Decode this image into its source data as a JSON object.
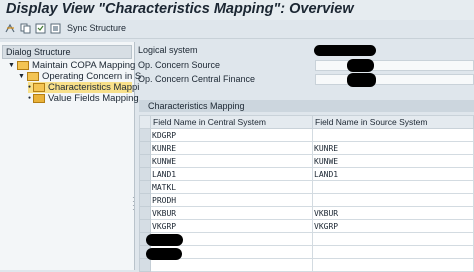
{
  "header": {
    "title": "Display View \"Characteristics Mapping\": Overview"
  },
  "toolbar": {
    "sync_label": "Sync Structure"
  },
  "dialog_structure": {
    "title": "Dialog Structure",
    "items": [
      {
        "label": "Maintain COPA Mapping",
        "expanded": true
      },
      {
        "label": "Operating Concern in S",
        "expanded": true
      },
      {
        "label": "Characteristics Mappi",
        "selected": true
      },
      {
        "label": "Value Fields Mapping"
      }
    ]
  },
  "fields": {
    "logical_system": "Logical system",
    "op_concern_source": "Op. Concern Source",
    "op_concern_central": "Op. Concern Central Finance"
  },
  "mapping": {
    "section_title": "Characteristics Mapping",
    "col_central": "Field Name in Central System",
    "col_source": "Field Name in Source System",
    "rows": [
      {
        "central": "KDGRP",
        "source": ""
      },
      {
        "central": "KUNRE",
        "source": "KUNRE"
      },
      {
        "central": "KUNWE",
        "source": "KUNWE"
      },
      {
        "central": "LAND1",
        "source": "LAND1"
      },
      {
        "central": "MATKL",
        "source": ""
      },
      {
        "central": "PRODH",
        "source": ""
      },
      {
        "central": "VKBUR",
        "source": "VKBUR"
      },
      {
        "central": "VKGRP",
        "source": "VKGRP"
      },
      {
        "central": "",
        "source": ""
      },
      {
        "central": "",
        "source": ""
      },
      {
        "central": "",
        "source": ""
      }
    ]
  }
}
